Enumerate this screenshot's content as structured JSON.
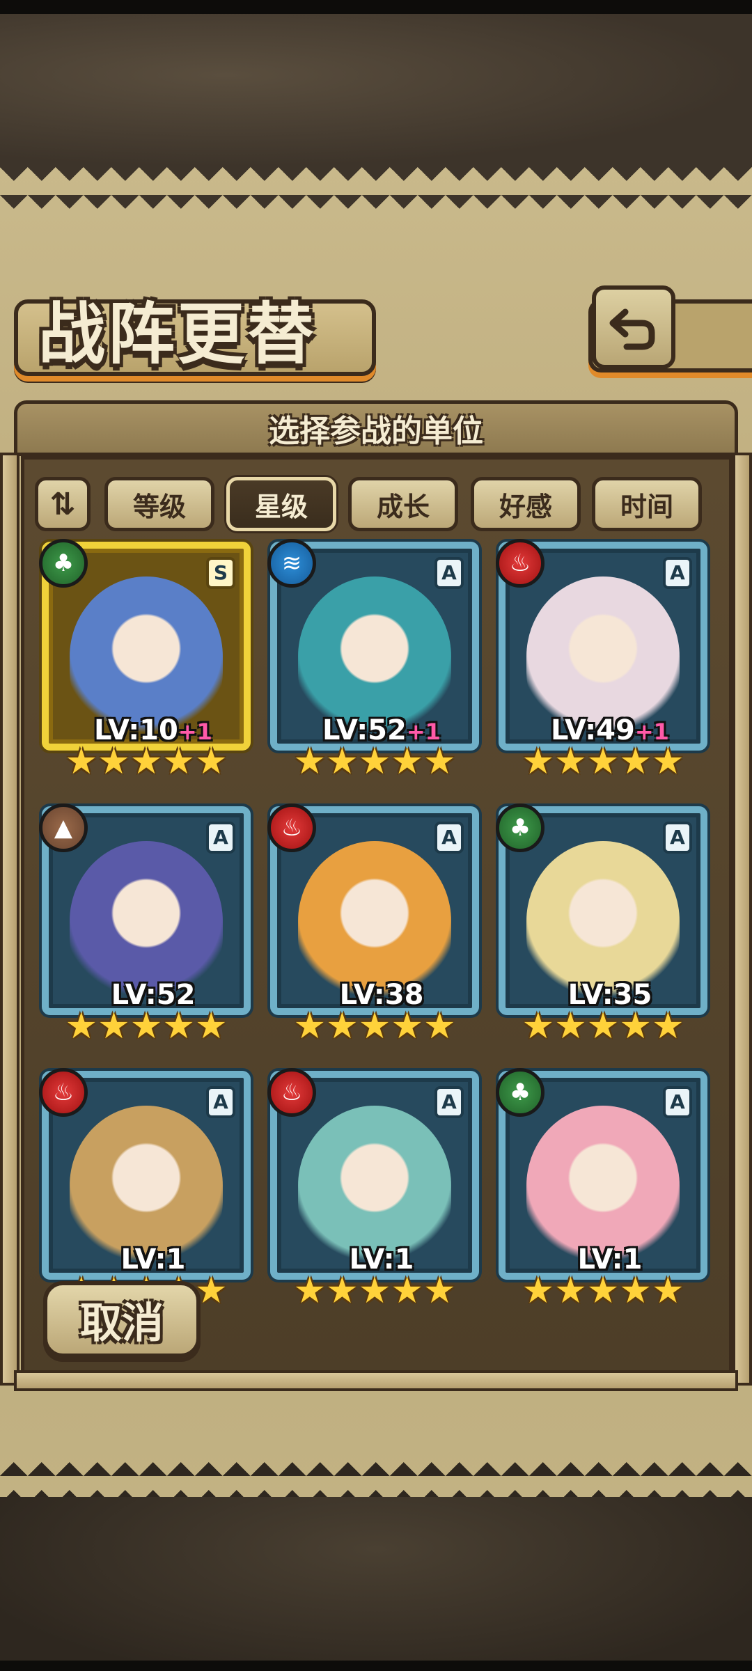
{
  "header": {
    "title": "战阵更替",
    "back_icon": "return-arrow-icon"
  },
  "subtitle": "选择参战的单位",
  "sort": {
    "toggle_icon": "sort-order-icon",
    "toggle_glyph": "⇅",
    "tabs": [
      {
        "label": "等级",
        "active": false
      },
      {
        "label": "星级",
        "active": true
      },
      {
        "label": "成长",
        "active": false
      },
      {
        "label": "好感",
        "active": false
      },
      {
        "label": "时间",
        "active": false
      }
    ]
  },
  "units": [
    {
      "element": "wood",
      "element_glyph": "♣",
      "rank": "S",
      "level": "LV:10",
      "bonus": "+1",
      "stars": 5,
      "frame": "gold",
      "palette": "#5a7fc8"
    },
    {
      "element": "water",
      "element_glyph": "≋",
      "rank": "A",
      "level": "LV:52",
      "bonus": "+1",
      "stars": 5,
      "frame": "blue",
      "palette": "#3aa0a8"
    },
    {
      "element": "fire",
      "element_glyph": "♨",
      "rank": "A",
      "level": "LV:49",
      "bonus": "+1",
      "stars": 5,
      "frame": "blue",
      "palette": "#e8d8e0"
    },
    {
      "element": "earth",
      "element_glyph": "▲",
      "rank": "A",
      "level": "LV:52",
      "bonus": "",
      "stars": 5,
      "frame": "blue",
      "palette": "#5a5aa8"
    },
    {
      "element": "fire",
      "element_glyph": "♨",
      "rank": "A",
      "level": "LV:38",
      "bonus": "",
      "stars": 5,
      "frame": "blue",
      "palette": "#e8a040"
    },
    {
      "element": "wood",
      "element_glyph": "♣",
      "rank": "A",
      "level": "LV:35",
      "bonus": "",
      "stars": 5,
      "frame": "blue",
      "palette": "#e8d898"
    },
    {
      "element": "fire",
      "element_glyph": "♨",
      "rank": "A",
      "level": "LV:1",
      "bonus": "",
      "stars": 5,
      "frame": "blue",
      "palette": "#c8a060"
    },
    {
      "element": "fire",
      "element_glyph": "♨",
      "rank": "A",
      "level": "LV:1",
      "bonus": "",
      "stars": 5,
      "frame": "blue",
      "palette": "#7ac0b8"
    },
    {
      "element": "wood",
      "element_glyph": "♣",
      "rank": "A",
      "level": "LV:1",
      "bonus": "",
      "stars": 5,
      "frame": "blue",
      "palette": "#f0a8b8"
    }
  ],
  "cancel_label": "取消"
}
